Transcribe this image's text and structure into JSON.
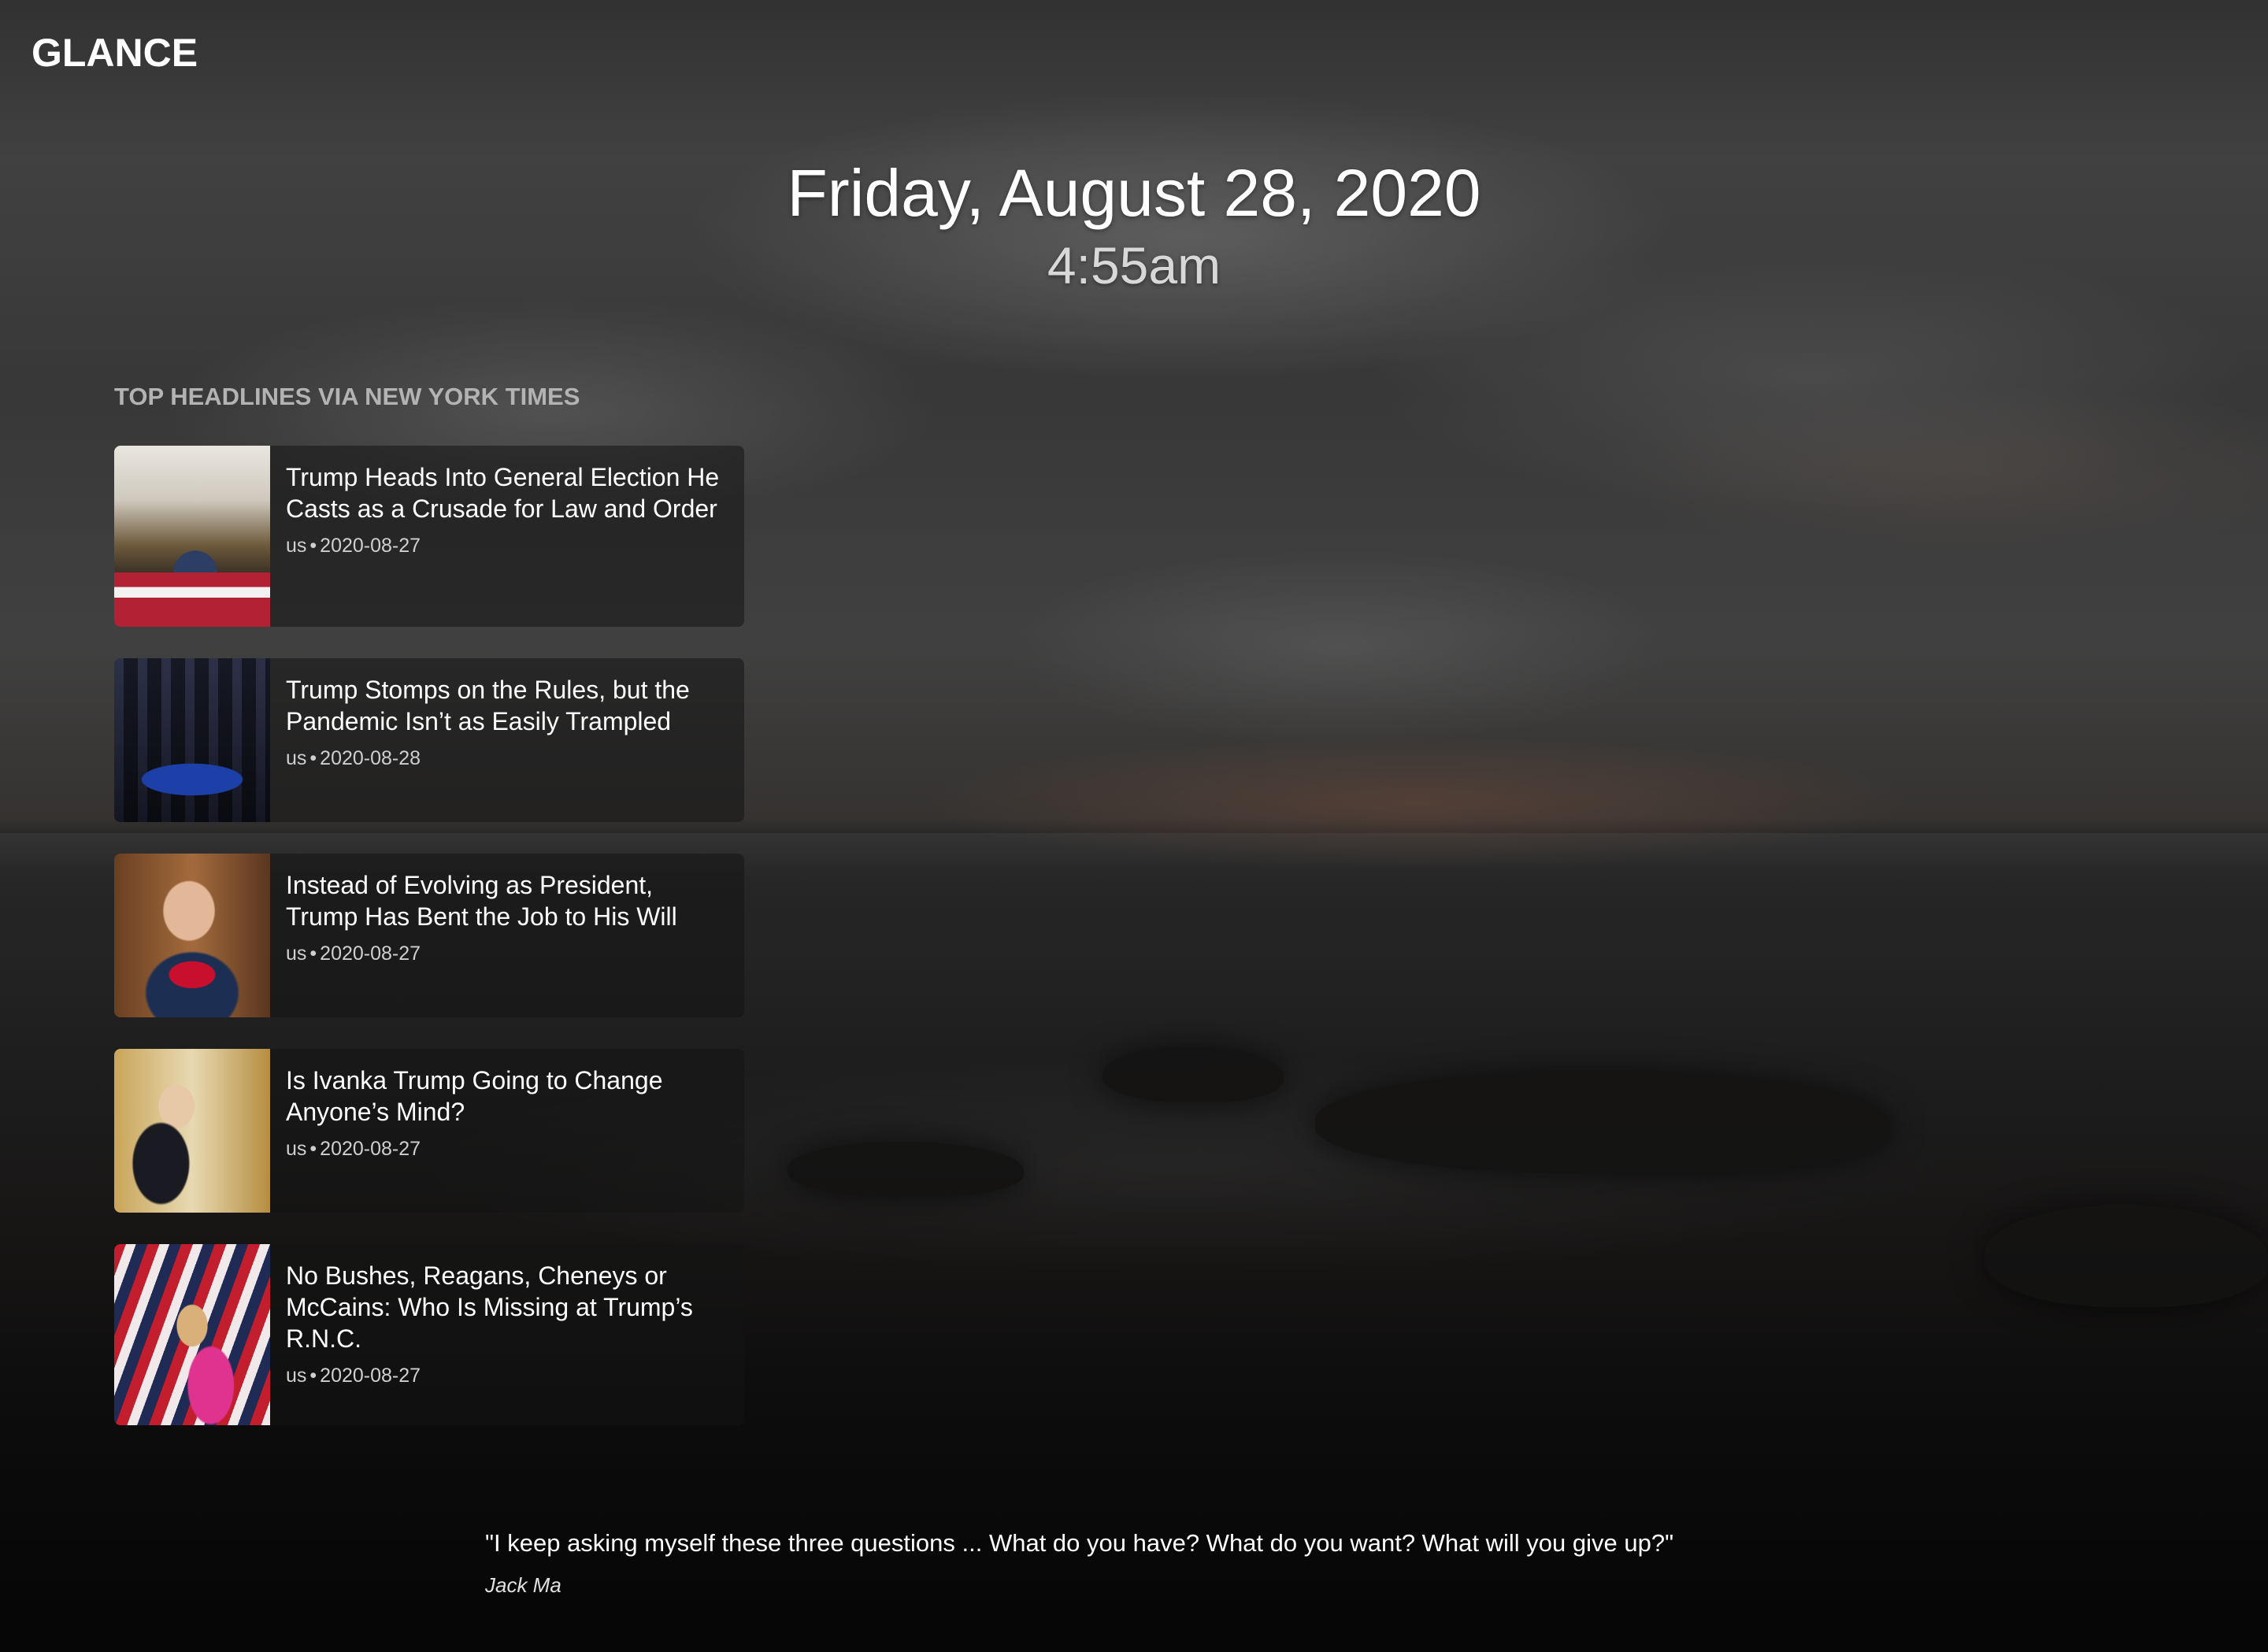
{
  "app": {
    "logo": "GLANCE"
  },
  "clock": {
    "date": "Friday, August 28, 2020",
    "time": "4:55am"
  },
  "headlines": {
    "section_title": "TOP HEADLINES VIA NEW YORK TIMES",
    "items": [
      {
        "title": "Trump Heads Into General Election He Casts as a Crusade for Law and Order",
        "section": "us",
        "separator": "•",
        "date": "2020-08-27",
        "thumbnail_icon": "podium-photo-icon"
      },
      {
        "title": "Trump Stomps on the Rules, but the Pandemic Isn’t as Easily Trampled",
        "section": "us",
        "separator": "•",
        "date": "2020-08-28",
        "thumbnail_icon": "rally-photo-icon"
      },
      {
        "title": "Instead of Evolving as President, Trump Has Bent the Job to His Will",
        "section": "us",
        "separator": "•",
        "date": "2020-08-27",
        "thumbnail_icon": "portrait-photo-icon"
      },
      {
        "title": "Is Ivanka Trump Going to Change Anyone’s Mind?",
        "section": "us",
        "separator": "•",
        "date": "2020-08-27",
        "thumbnail_icon": "event-photo-icon"
      },
      {
        "title": "No Bushes, Reagans, Cheneys or McCains: Who Is Missing at Trump’s R.N.C.",
        "section": "us",
        "separator": "•",
        "date": "2020-08-27",
        "thumbnail_icon": "convention-photo-icon"
      }
    ]
  },
  "quote": {
    "text": "\"I keep asking myself these three questions ... What do you have? What do you want? What will you give up?\"",
    "author": "Jack Ma"
  },
  "colors": {
    "background": "#0d0d0d",
    "text_primary": "#ffffff",
    "text_muted": "#b3b3b3",
    "card_background": "rgba(20,20,20,0.55)"
  }
}
